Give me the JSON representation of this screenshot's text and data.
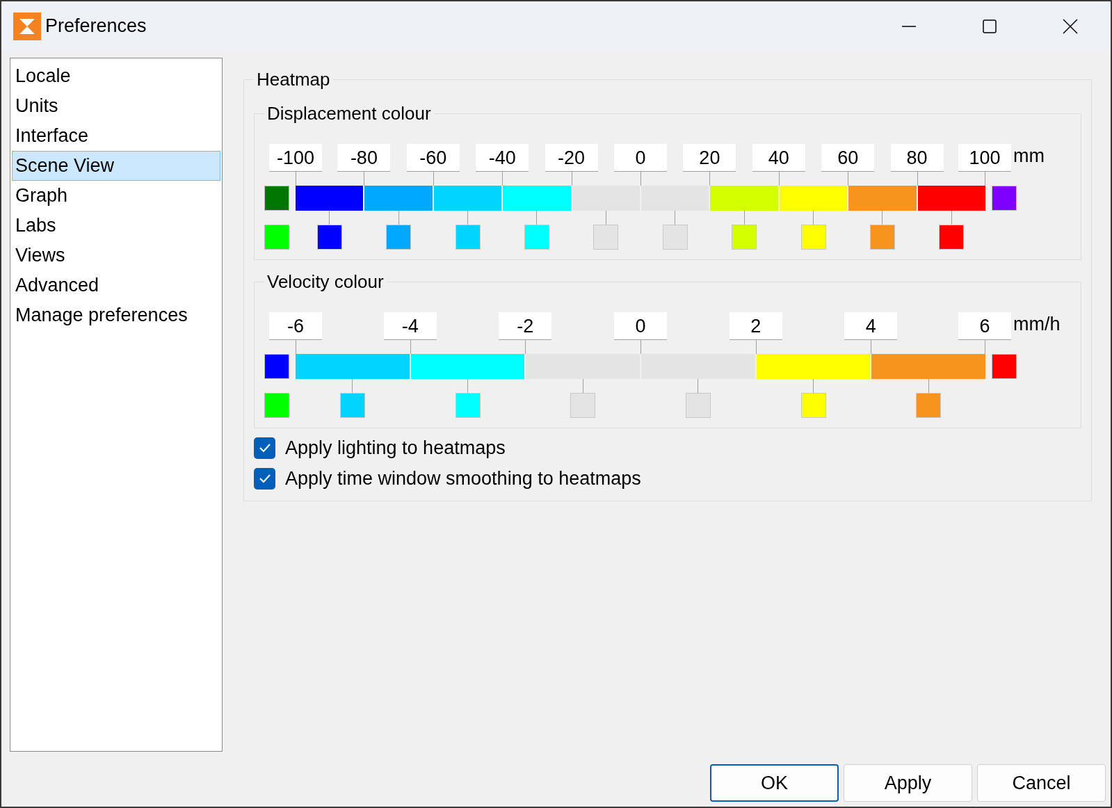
{
  "window": {
    "title": "Preferences"
  },
  "sidebar": {
    "items": [
      {
        "label": "Locale",
        "selected": false
      },
      {
        "label": "Units",
        "selected": false
      },
      {
        "label": "Interface",
        "selected": false
      },
      {
        "label": "Scene View",
        "selected": true
      },
      {
        "label": "Graph",
        "selected": false
      },
      {
        "label": "Labs",
        "selected": false
      },
      {
        "label": "Views",
        "selected": false
      },
      {
        "label": "Advanced",
        "selected": false
      },
      {
        "label": "Manage preferences",
        "selected": false
      }
    ]
  },
  "heatmap": {
    "title": "Heatmap",
    "scales": [
      {
        "title": "Displacement colour",
        "unit": "mm",
        "ticks": [
          "-100",
          "-80",
          "-60",
          "-40",
          "-20",
          "0",
          "20",
          "40",
          "60",
          "80",
          "100"
        ],
        "end_swatches": [
          {
            "kind": "underflow",
            "color": "#007800"
          },
          {
            "kind": "spare",
            "color": "#00ff00"
          },
          {
            "kind": "overflow",
            "color": "#8000ff"
          }
        ],
        "segments": [
          {
            "color": "#0000ff"
          },
          {
            "color": "#00a8ff"
          },
          {
            "color": "#00d4ff"
          },
          {
            "color": "#00ffff"
          },
          {
            "color": "#e4e4e4"
          },
          {
            "color": "#e4e4e4"
          },
          {
            "color": "#d4ff00"
          },
          {
            "color": "#ffff00"
          },
          {
            "color": "#f7941d"
          },
          {
            "color": "#ff0000"
          }
        ]
      },
      {
        "title": "Velocity colour",
        "unit": "mm/h",
        "ticks": [
          "-6",
          "-4",
          "-2",
          "0",
          "2",
          "4",
          "6"
        ],
        "end_swatches": [
          {
            "kind": "underflow",
            "color": "#0000ff"
          },
          {
            "kind": "spare",
            "color": "#00ff00"
          },
          {
            "kind": "overflow",
            "color": "#ff0000"
          }
        ],
        "segments": [
          {
            "color": "#00d4ff"
          },
          {
            "color": "#00ffff"
          },
          {
            "color": "#e4e4e4"
          },
          {
            "color": "#e4e4e4"
          },
          {
            "color": "#ffff00"
          },
          {
            "color": "#f7941d"
          }
        ]
      }
    ],
    "options": [
      {
        "label": "Apply lighting to heatmaps",
        "checked": true
      },
      {
        "label": "Apply time window smoothing to heatmaps",
        "checked": true
      }
    ]
  },
  "buttons": [
    {
      "label": "OK",
      "default": true
    },
    {
      "label": "Apply",
      "default": false
    },
    {
      "label": "Cancel",
      "default": false
    }
  ]
}
